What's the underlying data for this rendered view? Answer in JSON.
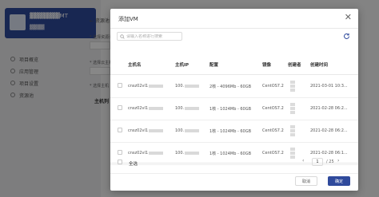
{
  "sidebar": {
    "project_name": "▓▓▓▓▓▓▓MT",
    "project_sub": "▓▓▓▓",
    "items": [
      "项目概览",
      "应用管理",
      "项目设置",
      "资源池"
    ]
  },
  "background": {
    "back_link": "← 资源池",
    "labels": [
      "* 选择资源池",
      "* 选择云主机",
      "* 选择主机"
    ],
    "section": "主机列"
  },
  "dialog": {
    "title": "添加VM",
    "search_placeholder": "请输入名称进行搜索",
    "columns": [
      "主机名",
      "主机IP",
      "配置",
      "镜像",
      "创建者",
      "创建时间"
    ],
    "rows": [
      {
        "name": "cnsz02vl1",
        "ip": "100.",
        "config": "2核 - 4096Mb - 60GB",
        "image": "CentOS7.2",
        "time": "2021-03-01 10:3..."
      },
      {
        "name": "cnsz02vl1",
        "ip": "100.",
        "config": "1核 - 1024Mb - 60GB",
        "image": "CentOS7.2",
        "time": "2021-02-28 06:2..."
      },
      {
        "name": "cnsz02vl1",
        "ip": "100.",
        "config": "1核 - 1024Mb - 60GB",
        "image": "CentOS7.2",
        "time": "2021-02-28 06:2..."
      },
      {
        "name": "cnsz02vl1",
        "ip": "100.",
        "config": "1核 - 1024Mb - 60GB",
        "image": "CentOS7.2",
        "time": "2021-02-28 06:1..."
      },
      {
        "name": "cnsz02vl1",
        "ip": "100.",
        "config": "1核 - 1024Mb - 60GB",
        "image": "CentOS7.2",
        "time": "2021-02-28 06:1..."
      }
    ],
    "select_all": "全选",
    "pagination": {
      "prev": "‹",
      "next": "›",
      "page": "1",
      "total": "/ 25"
    },
    "cancel_label": "取消",
    "ok_label": "确定"
  },
  "colors": {
    "primary": "#2f4a9c"
  }
}
